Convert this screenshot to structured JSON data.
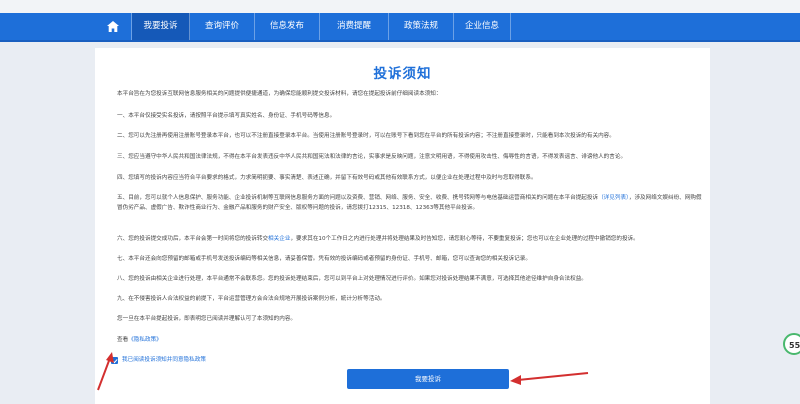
{
  "nav": {
    "items": [
      {
        "label": "我要投诉",
        "active": true
      },
      {
        "label": "查询评价",
        "active": false
      },
      {
        "label": "信息发布",
        "active": false
      },
      {
        "label": "消费提醒",
        "active": false
      },
      {
        "label": "政策法规",
        "active": false
      },
      {
        "label": "企业信息",
        "active": false
      }
    ]
  },
  "notice": {
    "title": "投诉须知",
    "intro": "本平台旨在为您投诉互联网信息服务相关的问题提供便捷通道，为确保您能顺利提交投诉材料，请您在提起投诉前仔细阅读本须知：",
    "p1": "一、本平台仅接受实名投诉，请按照平台提示填写真实姓名、身份证、手机号码等信息。",
    "p2": "二、您可以先注册再使用注册账号登录本平台，也可以不注册直接登录本平台。当使用注册账号登录时，可以在账号下看到您在平台的所有投诉内容；不注册直接登录时，只能看到本次投诉的有关内容。",
    "p3": "三、您应当遵守中华人民共和国法律法规，不得在本平台发表违反中华人民共和国宪法和法律的言论，实事求是反映问题，注意文明用语，不得使用攻击性、侮辱性的言语，不得发表谣言、诽谤他人的言论。",
    "p4": "四、您填写的投诉内容应当符合平台要求的格式，力求简明扼要、事实清楚、表述正确，并留下有效号码或其他有效联系方式，以便企业在处理过程中及时与您取得联系。",
    "p5a": "五、目前，您可以就个人信息保护、服务功能、企业投诉机制等互联网信息服务方面的问题以及资费、营销、网络、服务、安全、收费、携号转网等与电信基础运营商相关的问题在本平台提起投诉",
    "p5link": "（详见列表）",
    "p5b": "，涉及网络文娱纠纷、网购假冒伪劣产品、虚假广告、欺诈性商业行为、金融产品和服务的财产安全、版权等问题的投诉，请您拨打12315、12318、12363等其他平台投诉。",
    "p6a": "六、您的投诉提交成功后，本平台会第一时间将您的投诉转交",
    "p6link": "相关企业",
    "p6b": "，要求其在10个工作日之内进行处理并将处理结果及时告知您，请您耐心等待，不要重复投诉；您也可以在企业处理的过程中撤销您的投诉。",
    "p7": "七、本平台还会向您预留的邮箱或手机号发送投诉编码等相关信息，请妥善保管。凭有效的投诉编码或者预留的身份证、手机号、邮箱，您可以查询您的相关投诉记录。",
    "p8": "八、您的投诉由相关企业进行处理，本平台通常不会联系您。您的投诉处理结束后，您可以到平台上对处理情况进行评价。如果您对投诉处理结果不满意，可选择其他途径维护自身合法权益。",
    "p9": "九、在不侵害投诉人合法权益的前提下，平台运营管理方会合法合规地开展投诉案例分析，統计分析等活动。",
    "p10": "您一旦在本平台提起投诉，即表明您已阅读并理解认可了本须知的内容。",
    "privacy_prefix": "查看",
    "privacy_link": "《隐私政策》"
  },
  "agree": {
    "label": "我已阅读投诉须知并同意隐私政策",
    "checked": true
  },
  "submit_label": "我要投诉",
  "badge_text": "55",
  "colors": {
    "primary": "#1e6fd9",
    "annotation": "#d32f2f"
  }
}
